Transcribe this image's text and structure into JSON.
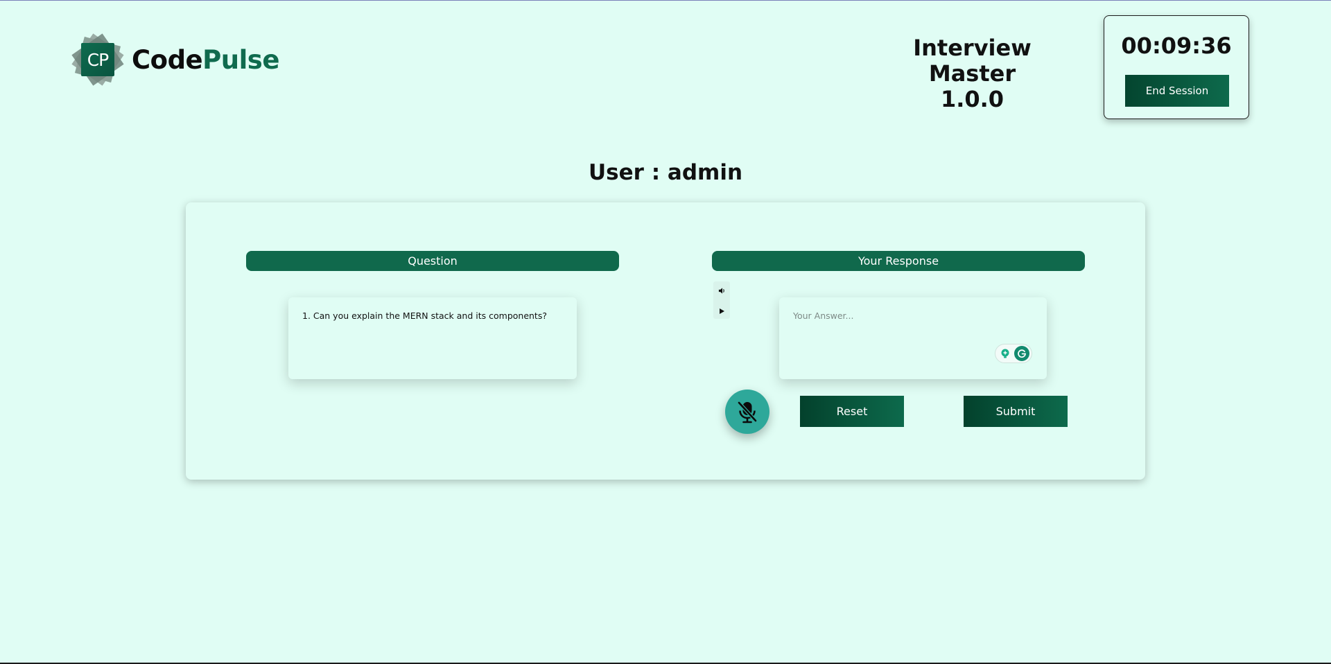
{
  "brand": {
    "logo_mark_text": "CP",
    "name_part1": "Code",
    "name_part2": "Pulse",
    "accent_color": "#0f6b4e"
  },
  "header": {
    "app_title": "Interview Master",
    "app_version": "1.0.0"
  },
  "timer": {
    "value": "00:09:36",
    "end_session_label": "End Session"
  },
  "user": {
    "label": "User",
    "separator": ":",
    "name": "admin"
  },
  "question_panel": {
    "header": "Question",
    "text": "1. Can you explain the MERN stack and its components?"
  },
  "response_panel": {
    "header": "Your Response",
    "placeholder": "Your Answer...",
    "value": "",
    "icons": [
      "speaker-icon",
      "play-icon",
      "lightbulb-icon",
      "grammarly-icon",
      "mic-off-icon"
    ]
  },
  "actions": {
    "reset_label": "Reset",
    "submit_label": "Submit"
  }
}
